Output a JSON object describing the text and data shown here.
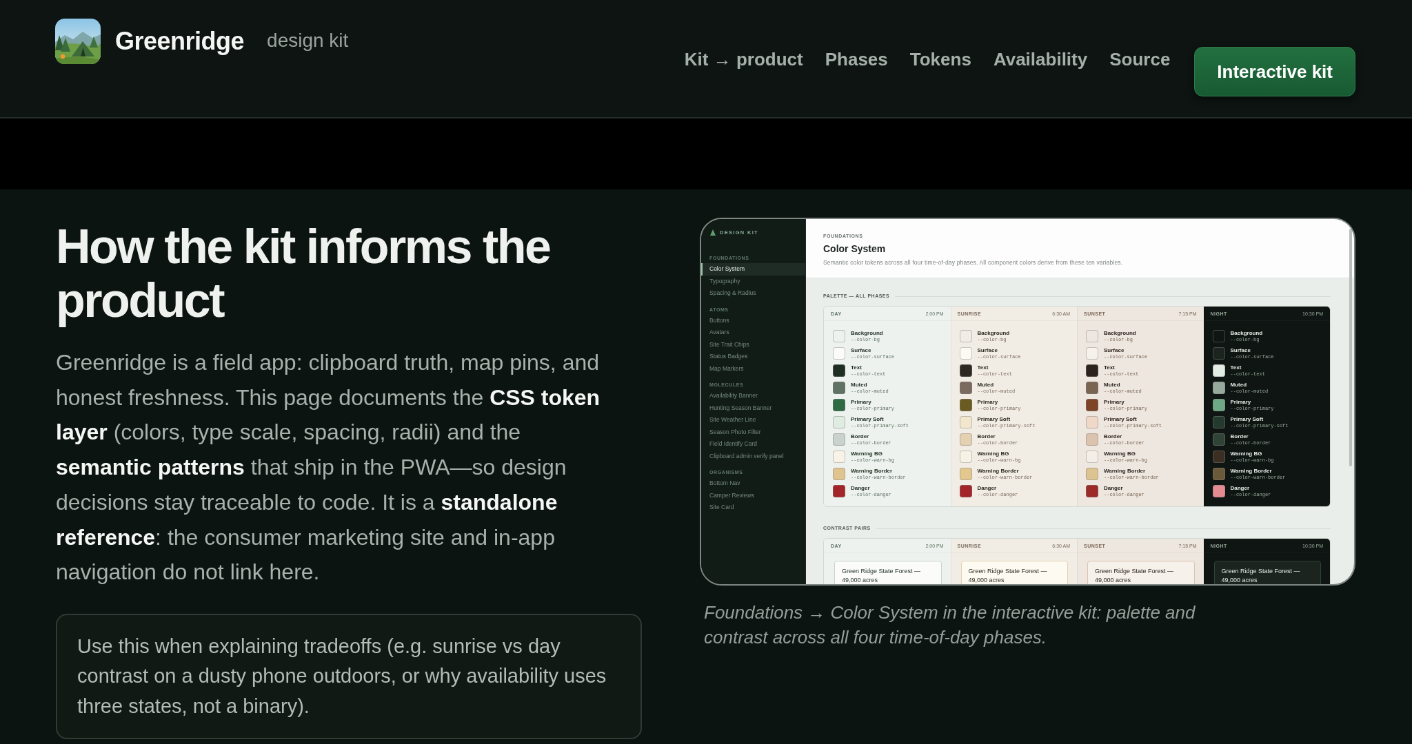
{
  "header": {
    "brand": "Greenridge",
    "tagline": "design kit",
    "nav": [
      {
        "label": "Kit → product"
      },
      {
        "label": "Phases"
      },
      {
        "label": "Tokens"
      },
      {
        "label": "Availability"
      },
      {
        "label": "Source"
      }
    ],
    "cta": "Interactive kit"
  },
  "hero": {
    "title": "How the kit informs the product",
    "intro": "Greenridge is a field app: clipboard truth, map pins, and honest freshness. This page documents the **CSS token layer** (colors, type scale, spacing, radii) and the **semantic patterns** that ship in the PWA—so design decisions stay traceable to code. It is a **standalone reference**: the consumer marketing site and in-app navigation do not link here.",
    "note": "Use this when explaining tradeoffs (e.g. sunrise vs day contrast on a dusty phone outdoors, or why availability uses three states, not a binary)."
  },
  "screenshot": {
    "sidebar": {
      "brand": "DESIGN KIT",
      "groups": [
        {
          "heading": "FOUNDATIONS",
          "items": [
            {
              "label": "Color System",
              "selected": true
            },
            {
              "label": "Typography",
              "selected": false
            },
            {
              "label": "Spacing & Radius",
              "selected": false
            }
          ]
        },
        {
          "heading": "ATOMS",
          "items": [
            {
              "label": "Buttons",
              "selected": false
            },
            {
              "label": "Avatars",
              "selected": false
            },
            {
              "label": "Site Trait Chips",
              "selected": false
            },
            {
              "label": "Status Badges",
              "selected": false
            },
            {
              "label": "Map Markers",
              "selected": false
            }
          ]
        },
        {
          "heading": "MOLECULES",
          "items": [
            {
              "label": "Availability Banner",
              "selected": false
            },
            {
              "label": "Hunting Season Banner",
              "selected": false
            },
            {
              "label": "Site Weather Line",
              "selected": false
            },
            {
              "label": "Season Photo Filter",
              "selected": false
            },
            {
              "label": "Field Identify Card",
              "selected": false
            },
            {
              "label": "Clipboard admin verify panel",
              "selected": false
            }
          ]
        },
        {
          "heading": "ORGANISMS",
          "items": [
            {
              "label": "Bottom Nav",
              "selected": false
            },
            {
              "label": "Camper Reviews",
              "selected": false
            },
            {
              "label": "Site Card",
              "selected": false
            }
          ]
        }
      ]
    },
    "page": {
      "eyebrow": "FOUNDATIONS",
      "title": "Color System",
      "description": "Semantic color tokens across all four time-of-day phases. All component colors derive from these ten variables.",
      "palette": {
        "heading": "PALETTE — ALL PHASES",
        "phases": [
          {
            "name": "DAY",
            "time": "2:00 PM",
            "tokens": [
              {
                "name": "Background",
                "variable": "--color-bg",
                "color": "#eef2ee"
              },
              {
                "name": "Surface",
                "variable": "--color-surface",
                "color": "#fbfcfa"
              },
              {
                "name": "Text",
                "variable": "--color-text",
                "color": "#1e2e22"
              },
              {
                "name": "Muted",
                "variable": "--color-muted",
                "color": "#5f7264"
              },
              {
                "name": "Primary",
                "variable": "--color-primary",
                "color": "#2e6b43"
              },
              {
                "name": "Primary Soft",
                "variable": "--color-primary-soft",
                "color": "#dfece2"
              },
              {
                "name": "Border",
                "variable": "--color-border",
                "color": "#c9d3cb"
              },
              {
                "name": "Warning BG",
                "variable": "--color-warn-bg",
                "color": "#f8f3e6"
              },
              {
                "name": "Warning Border",
                "variable": "--color-warn-border",
                "color": "#e0c48f"
              },
              {
                "name": "Danger",
                "variable": "--color-danger",
                "color": "#a42529"
              }
            ]
          },
          {
            "name": "SUNRISE",
            "time": "6:30 AM",
            "tokens": [
              {
                "name": "Background",
                "variable": "--color-bg",
                "color": "#f1ece4"
              },
              {
                "name": "Surface",
                "variable": "--color-surface",
                "color": "#fdfaf1"
              },
              {
                "name": "Text",
                "variable": "--color-text",
                "color": "#2e2a22"
              },
              {
                "name": "Muted",
                "variable": "--color-muted",
                "color": "#7a6b5e"
              },
              {
                "name": "Primary",
                "variable": "--color-primary",
                "color": "#6b5a22"
              },
              {
                "name": "Primary Soft",
                "variable": "--color-primary-soft",
                "color": "#f2e6cc"
              },
              {
                "name": "Border",
                "variable": "--color-border",
                "color": "#e3d1b2"
              },
              {
                "name": "Warning BG",
                "variable": "--color-warn-bg",
                "color": "#f7f2e6"
              },
              {
                "name": "Warning Border",
                "variable": "--color-warn-border",
                "color": "#e2c88e"
              },
              {
                "name": "Danger",
                "variable": "--color-danger",
                "color": "#a42529"
              }
            ]
          },
          {
            "name": "SUNSET",
            "time": "7:15 PM",
            "tokens": [
              {
                "name": "Background",
                "variable": "--color-bg",
                "color": "#eee7e0"
              },
              {
                "name": "Surface",
                "variable": "--color-surface",
                "color": "#f6f1ea"
              },
              {
                "name": "Text",
                "variable": "--color-text",
                "color": "#2c231d"
              },
              {
                "name": "Muted",
                "variable": "--color-muted",
                "color": "#7a6552"
              },
              {
                "name": "Primary",
                "variable": "--color-primary",
                "color": "#7e4426"
              },
              {
                "name": "Primary Soft",
                "variable": "--color-primary-soft",
                "color": "#efd8c8"
              },
              {
                "name": "Border",
                "variable": "--color-border",
                "color": "#dcc3ad"
              },
              {
                "name": "Warning BG",
                "variable": "--color-warn-bg",
                "color": "#f4efe6"
              },
              {
                "name": "Warning Border",
                "variable": "--color-warn-border",
                "color": "#dcc38f"
              },
              {
                "name": "Danger",
                "variable": "--color-danger",
                "color": "#9c2a28"
              }
            ]
          },
          {
            "name": "NIGHT",
            "time": "10:30 PM",
            "tokens": [
              {
                "name": "Background",
                "variable": "--color-bg",
                "color": "#0f1512"
              },
              {
                "name": "Surface",
                "variable": "--color-surface",
                "color": "#1b241f"
              },
              {
                "name": "Text",
                "variable": "--color-text",
                "color": "#e3ebe5"
              },
              {
                "name": "Muted",
                "variable": "--color-muted",
                "color": "#97a89c"
              },
              {
                "name": "Primary",
                "variable": "--color-primary",
                "color": "#6fa884"
              },
              {
                "name": "Primary Soft",
                "variable": "--color-primary-soft",
                "color": "#253a2e"
              },
              {
                "name": "Border",
                "variable": "--color-border",
                "color": "#2f4437"
              },
              {
                "name": "Warning BG",
                "variable": "--color-warn-bg",
                "color": "#3a2f22"
              },
              {
                "name": "Warning Border",
                "variable": "--color-warn-border",
                "color": "#6b5a3a"
              },
              {
                "name": "Danger",
                "variable": "--color-danger",
                "color": "#e58a91"
              }
            ]
          }
        ]
      },
      "contrast": {
        "heading": "CONTRAST PAIRS",
        "phases": [
          {
            "name": "DAY",
            "time": "2:00 PM",
            "sample": "Green Ridge State Forest — 49,000 acres"
          },
          {
            "name": "SUNRISE",
            "time": "6:30 AM",
            "sample": "Green Ridge State Forest — 49,000 acres"
          },
          {
            "name": "SUNSET",
            "time": "7:15 PM",
            "sample": "Green Ridge State Forest — 49,000 acres"
          },
          {
            "name": "NIGHT",
            "time": "10:30 PM",
            "sample": "Green Ridge State Forest — 49,000 acres"
          }
        ]
      }
    }
  },
  "caption": "Foundations → Color System in the interactive kit: palette and contrast across all four time-of-day phases."
}
